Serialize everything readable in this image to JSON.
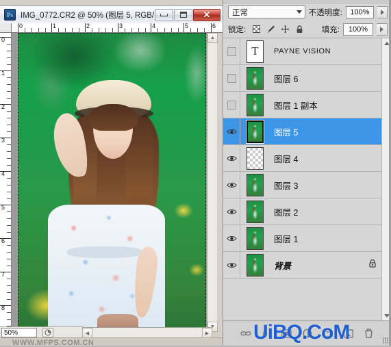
{
  "document_window": {
    "app_icon": "photoshop-ps-icon",
    "title": "IMG_0772.CR2 @ 50% (图层 5, RGB/...",
    "window_buttons": [
      {
        "name": "minimize",
        "glyph": "minimize-icon"
      },
      {
        "name": "maximize",
        "glyph": "maximize-icon"
      },
      {
        "name": "close",
        "glyph": "✕"
      }
    ],
    "rulers": {
      "horizontal_labels": [
        "0",
        "1",
        "2",
        "3",
        "4",
        "5",
        "6"
      ],
      "vertical_labels": [
        "0",
        "1",
        "2",
        "3",
        "4",
        "5",
        "6",
        "7",
        "8"
      ],
      "unit": "inches"
    },
    "status_bar": {
      "zoom_level": "50%",
      "doc_info_icon": "document-info-icon"
    },
    "watermark": "WWW.MFPS.COM.CN",
    "canvas_image_description": "young woman in straw hat and floral dress in green field with yellow flowers"
  },
  "layers_panel": {
    "blend_mode": {
      "label": "",
      "value": "正常",
      "dropdown_icon": "chevron-down-icon"
    },
    "opacity": {
      "label": "不透明度:",
      "value": "100%",
      "stepper_icon": "chevron-right-icon"
    },
    "lock": {
      "label": "锁定:",
      "icons": [
        {
          "name": "lock-transparent-pixels-icon"
        },
        {
          "name": "lock-image-pixels-brush-icon",
          "glyph": "✎"
        },
        {
          "name": "lock-position-move-icon",
          "glyph": "✛"
        },
        {
          "name": "lock-all-padlock-icon",
          "glyph": "🔒"
        }
      ]
    },
    "fill": {
      "label": "填充:",
      "value": "100%",
      "stepper_icon": "chevron-right-icon"
    },
    "layers": [
      {
        "name": "PAYNE VISION",
        "visible": false,
        "selected": false,
        "thumb": "text",
        "locked": false,
        "italic": false,
        "small": true
      },
      {
        "name": "图层 6",
        "visible": false,
        "selected": false,
        "thumb": "photo",
        "locked": false,
        "italic": false,
        "small": false
      },
      {
        "name": "图层 1 副本",
        "visible": false,
        "selected": false,
        "thumb": "photo",
        "locked": false,
        "italic": false,
        "small": false
      },
      {
        "name": "图层 5",
        "visible": true,
        "selected": true,
        "thumb": "photo",
        "locked": false,
        "italic": false,
        "small": false
      },
      {
        "name": "图层 4",
        "visible": true,
        "selected": false,
        "thumb": "checker",
        "locked": false,
        "italic": false,
        "small": false
      },
      {
        "name": "图层 3",
        "visible": true,
        "selected": false,
        "thumb": "photo",
        "locked": false,
        "italic": false,
        "small": false
      },
      {
        "name": "图层 2",
        "visible": true,
        "selected": false,
        "thumb": "photo",
        "locked": false,
        "italic": false,
        "small": false
      },
      {
        "name": "图层 1",
        "visible": true,
        "selected": false,
        "thumb": "photo",
        "locked": false,
        "italic": false,
        "small": false
      },
      {
        "name": "背景",
        "visible": true,
        "selected": false,
        "thumb": "photo",
        "locked": true,
        "italic": true,
        "small": false
      }
    ],
    "bottom_toolbar": [
      {
        "name": "link-layers-icon",
        "glyph": "⚭"
      },
      {
        "name": "layer-style-fx-icon",
        "glyph": "fx"
      },
      {
        "name": "add-layer-mask-icon",
        "glyph": "◙"
      },
      {
        "name": "new-fill-adjustment-layer-icon",
        "glyph": "◑"
      },
      {
        "name": "new-group-folder-icon",
        "glyph": "▭"
      },
      {
        "name": "new-layer-icon",
        "glyph": "▣"
      },
      {
        "name": "delete-layer-trash-icon",
        "glyph": "🗑"
      }
    ],
    "scrollbar": {
      "up_icon": "scroll-up-arrow-icon",
      "down_icon": "scroll-down-arrow-icon"
    },
    "watermark": "UiBQ.CoM"
  },
  "colors": {
    "selection_blue": "#3d95e8",
    "panel_bg": "#d6d6d6",
    "watermark_blue": "#1f5fd0",
    "close_button_red": "#c0392b"
  }
}
